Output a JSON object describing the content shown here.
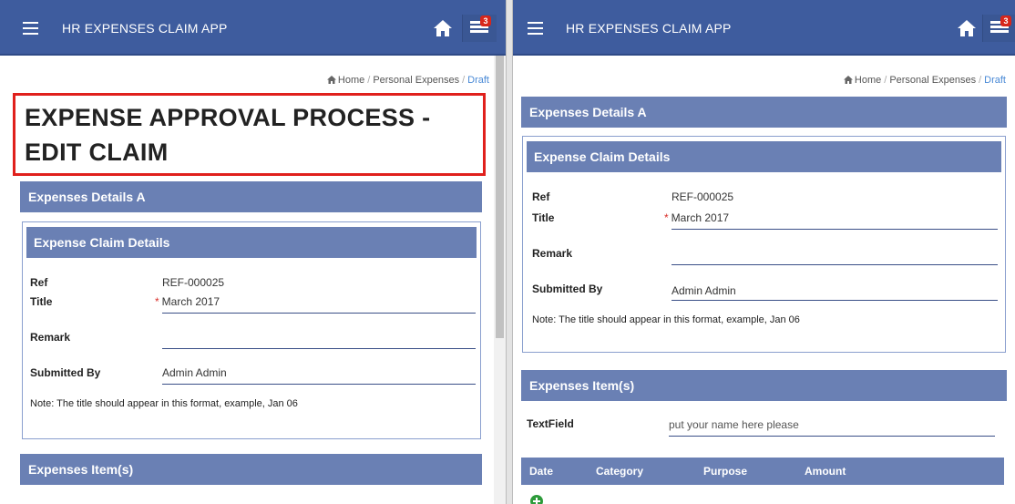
{
  "app": {
    "title": "HR EXPENSES CLAIM APP",
    "notification_count": "3"
  },
  "breadcrumb": {
    "home": "Home",
    "section": "Personal Expenses",
    "current": "Draft"
  },
  "page_title_line1": "EXPENSE APPROVAL PROCESS -",
  "page_title_line2": "EDIT CLAIM",
  "section_a": "Expenses Details A",
  "claim_details": {
    "header": "Expense Claim Details",
    "ref_label": "Ref",
    "ref_value": "REF-000025",
    "title_label": "Title",
    "title_required": "*",
    "title_value": "March 2017",
    "remark_label": "Remark",
    "remark_value": "",
    "submitted_by_label": "Submitted By",
    "submitted_by_value": "Admin Admin",
    "note": "Note: The title should appear in this format, example, Jan 06"
  },
  "items": {
    "header": "Expenses Item(s)",
    "textfield_label": "TextField",
    "textfield_placeholder": "put your name here please",
    "columns": [
      "Date",
      "Category",
      "Purpose",
      "Amount"
    ]
  },
  "icons": {
    "menu": "hamburger-icon",
    "home": "home-icon",
    "notifications": "notification-list-icon",
    "add": "add-circle-icon"
  },
  "colors": {
    "navbar": "#3e5c9e",
    "section": "#6a80b4",
    "highlight": "#e0201c",
    "add": "#2d9b3a"
  }
}
